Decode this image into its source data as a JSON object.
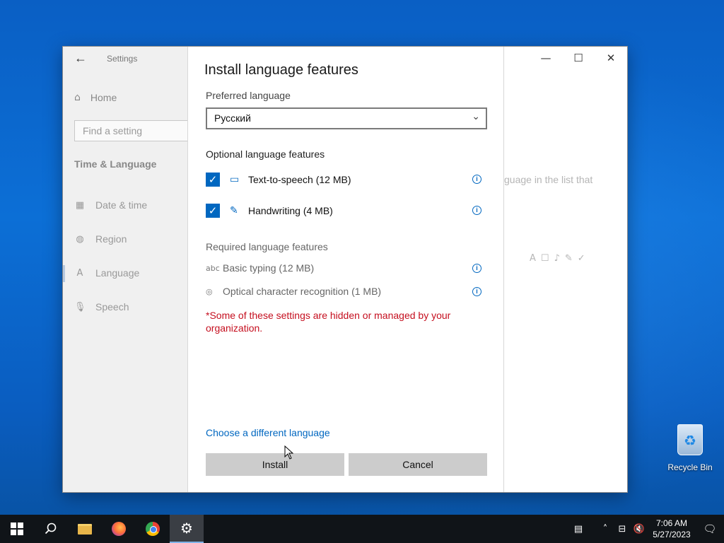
{
  "window": {
    "title": "Settings",
    "minimize": "—",
    "maximize": "☐",
    "close": "✕"
  },
  "sidebar": {
    "home": "Home",
    "search_placeholder": "Find a setting",
    "section": "Time & Language",
    "items": [
      {
        "label": "Date & time",
        "icon": "calendar-icon"
      },
      {
        "label": "Region",
        "icon": "globe-icon"
      },
      {
        "label": "Language",
        "icon": "language-icon"
      },
      {
        "label": "Speech",
        "icon": "microphone-icon"
      }
    ]
  },
  "background": {
    "partial_text": "guage in the list that"
  },
  "dialog": {
    "title": "Install language features",
    "preferred_language_label": "Preferred language",
    "preferred_language_value": "Русский",
    "optional_label": "Optional language features",
    "optional_features": [
      {
        "label": "Text-to-speech (12 MB)",
        "checked": true,
        "icon": "speech-icon"
      },
      {
        "label": "Handwriting (4 MB)",
        "checked": true,
        "icon": "handwriting-icon"
      }
    ],
    "required_label": "Required language features",
    "required_features": [
      {
        "label": "Basic typing (12 MB)",
        "icon": "spellcheck-icon"
      },
      {
        "label": "Optical character recognition (1 MB)",
        "icon": "camera-icon"
      }
    ],
    "warning": "*Some of these settings are hidden or managed by your organization.",
    "link": "Choose a different language",
    "install_button": "Install",
    "cancel_button": "Cancel"
  },
  "desktop": {
    "recycle_bin": "Recycle Bin"
  },
  "taskbar": {
    "time": "7:06 AM",
    "date": "5/27/2023"
  },
  "colors": {
    "accent": "#0067c0",
    "warning": "#c50f1f"
  }
}
